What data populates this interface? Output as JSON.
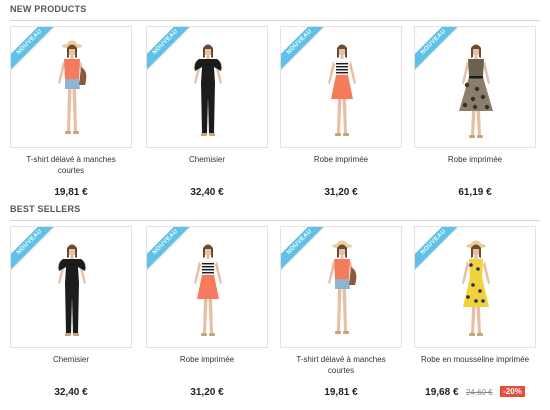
{
  "sections": {
    "new": {
      "title": "NEW PRODUCTS",
      "products": [
        {
          "name": "T-shirt délavé à manches courtes",
          "price": "19,81 €",
          "ribbon": "NOUVEAU"
        },
        {
          "name": "Chemisier",
          "price": "32,40 €",
          "ribbon": "NOUVEAU"
        },
        {
          "name": "Robe imprimée",
          "price": "31,20 €",
          "ribbon": "NOUVEAU"
        },
        {
          "name": "Robe imprimée",
          "price": "61,19 €",
          "ribbon": "NOUVEAU"
        }
      ]
    },
    "best": {
      "title": "BEST SELLERS",
      "products": [
        {
          "name": "Chemisier",
          "price": "32,40 €",
          "ribbon": "NOUVEAU"
        },
        {
          "name": "Robe imprimée",
          "price": "31,20 €",
          "ribbon": "NOUVEAU"
        },
        {
          "name": "T-shirt délavé à manches courtes",
          "price": "19,81 €",
          "ribbon": "NOUVEAU"
        },
        {
          "name": "Robe en mousseline imprimée",
          "price": "19,68 €",
          "old_price": "24,60 €",
          "discount": "-20%",
          "ribbon": "NOUVEAU"
        }
      ]
    }
  },
  "colors": {
    "ribbon": "#5fc0e8",
    "discount": "#e84c3d",
    "skin": "#e7c0a3",
    "hair": "#6b4a33",
    "hat": "#e7cf9c",
    "coral": "#f47c5c",
    "black": "#1c1c1c",
    "denim": "#8fb3d0"
  },
  "icons": [
    "tshirt-model-image",
    "black-blouse-model-image",
    "striped-coral-dress-model-image",
    "printed-dress-model-image",
    "yellow-floral-dress-model-image"
  ]
}
